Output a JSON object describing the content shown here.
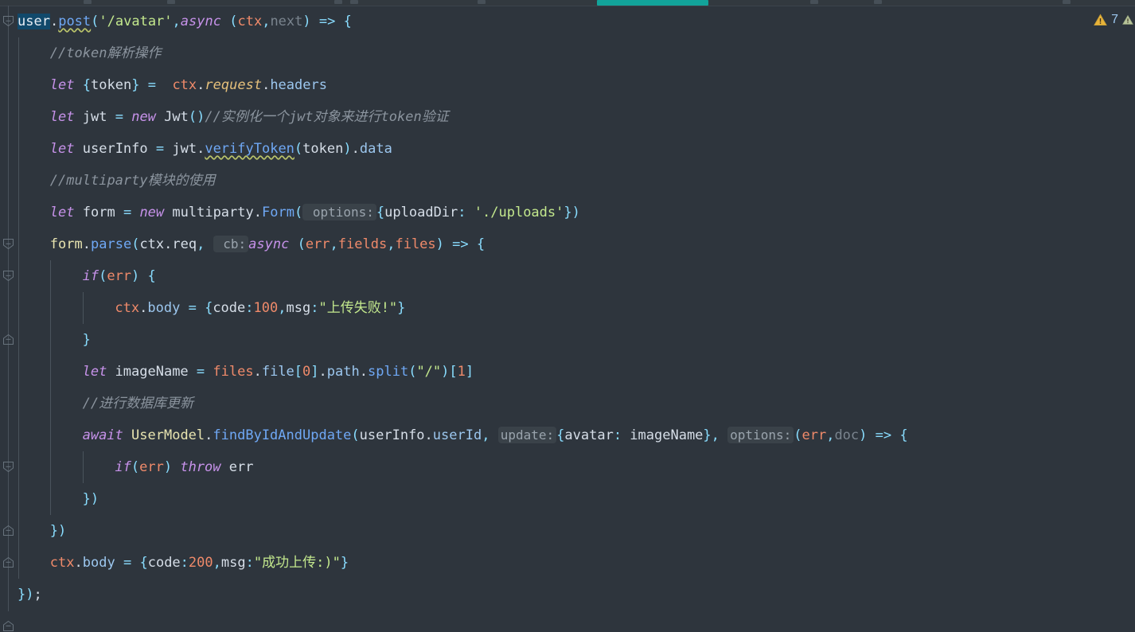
{
  "app": {
    "kind": "code-editor",
    "background": "#2e353d",
    "font_size_px": 17,
    "line_height_px": 40
  },
  "toolbar": {
    "active_tab_color": "#12a39a"
  },
  "status_bar": {
    "warning_icon": "warning-triangle-icon",
    "warning_count": "7",
    "secondary_icon": "weak-warning-triangle-icon"
  },
  "gutter": {
    "fold_markers": [
      {
        "type": "fold-start",
        "line": 1
      },
      {
        "type": "fold-start",
        "line": 8
      },
      {
        "type": "fold-start",
        "line": 9
      },
      {
        "type": "fold-end",
        "line": 11
      },
      {
        "type": "fold-start",
        "line": 15
      },
      {
        "type": "fold-end",
        "line": 17
      },
      {
        "type": "fold-end",
        "line": 18
      },
      {
        "type": "fold-end",
        "line": 20
      }
    ]
  },
  "code": {
    "language": "javascript",
    "selected_token": "user",
    "lines": [
      {
        "n": 1,
        "indent": 0,
        "tokens": [
          {
            "t": "user",
            "c": "obj sel"
          },
          {
            "t": ".",
            "c": "id"
          },
          {
            "t": "post",
            "c": "fn wavy"
          },
          {
            "t": "(",
            "c": "punc"
          },
          {
            "t": "'/avatar'",
            "c": "str"
          },
          {
            "t": ",",
            "c": "punc"
          },
          {
            "t": "async",
            "c": "kw"
          },
          {
            "t": " ",
            "c": "id"
          },
          {
            "t": "(",
            "c": "punc"
          },
          {
            "t": "ctx",
            "c": "obj"
          },
          {
            "t": ",",
            "c": "punc"
          },
          {
            "t": "next",
            "c": "dim"
          },
          {
            "t": ")",
            "c": "punc"
          },
          {
            "t": " => ",
            "c": "punc"
          },
          {
            "t": "{",
            "c": "punc"
          }
        ]
      },
      {
        "n": 2,
        "indent": 1,
        "tokens": [
          {
            "t": "//token解析操作",
            "c": "cmt"
          }
        ]
      },
      {
        "n": 3,
        "indent": 1,
        "tokens": [
          {
            "t": "let",
            "c": "kw"
          },
          {
            "t": " ",
            "c": "id"
          },
          {
            "t": "{",
            "c": "punc"
          },
          {
            "t": "token",
            "c": "id"
          },
          {
            "t": "}",
            "c": "punc"
          },
          {
            "t": " ",
            "c": "id"
          },
          {
            "t": "=",
            "c": "op"
          },
          {
            "t": "  ",
            "c": "id"
          },
          {
            "t": "ctx",
            "c": "obj"
          },
          {
            "t": ".",
            "c": "id"
          },
          {
            "t": "request",
            "c": "propy"
          },
          {
            "t": ".",
            "c": "id"
          },
          {
            "t": "headers",
            "c": "prop"
          }
        ]
      },
      {
        "n": 4,
        "indent": 1,
        "tokens": [
          {
            "t": "let",
            "c": "kw"
          },
          {
            "t": " jwt ",
            "c": "id"
          },
          {
            "t": "=",
            "c": "op"
          },
          {
            "t": " ",
            "c": "id"
          },
          {
            "t": "new",
            "c": "kw"
          },
          {
            "t": " Jwt",
            "c": "id"
          },
          {
            "t": "()",
            "c": "punc"
          },
          {
            "t": "//实例化一个jwt对象来进行token验证",
            "c": "cmt"
          }
        ]
      },
      {
        "n": 5,
        "indent": 1,
        "tokens": [
          {
            "t": "let",
            "c": "kw"
          },
          {
            "t": " userInfo ",
            "c": "id"
          },
          {
            "t": "=",
            "c": "op"
          },
          {
            "t": " jwt",
            "c": "id"
          },
          {
            "t": ".",
            "c": "id"
          },
          {
            "t": "verifyToken",
            "c": "fn wavy"
          },
          {
            "t": "(",
            "c": "punc"
          },
          {
            "t": "token",
            "c": "id"
          },
          {
            "t": ")",
            "c": "punc"
          },
          {
            "t": ".",
            "c": "id"
          },
          {
            "t": "data",
            "c": "prop"
          }
        ]
      },
      {
        "n": 6,
        "indent": 1,
        "tokens": [
          {
            "t": "//multiparty模块的使用",
            "c": "cmt"
          }
        ]
      },
      {
        "n": 7,
        "indent": 1,
        "tokens": [
          {
            "t": "let",
            "c": "kw"
          },
          {
            "t": " form ",
            "c": "id"
          },
          {
            "t": "=",
            "c": "op"
          },
          {
            "t": " ",
            "c": "id"
          },
          {
            "t": "new",
            "c": "kw"
          },
          {
            "t": " multiparty",
            "c": "id"
          },
          {
            "t": ".",
            "c": "id"
          },
          {
            "t": "Form",
            "c": "fn"
          },
          {
            "t": "(",
            "c": "punc"
          },
          {
            "t": " options:",
            "c": "hint"
          },
          {
            "t": "{",
            "c": "punc"
          },
          {
            "t": "uploadDir",
            "c": "id"
          },
          {
            "t": ":",
            "c": "punc"
          },
          {
            "t": " ",
            "c": "id"
          },
          {
            "t": "'./uploads'",
            "c": "str"
          },
          {
            "t": "}",
            "c": "punc"
          },
          {
            "t": ")",
            "c": "punc"
          }
        ]
      },
      {
        "n": 8,
        "indent": 1,
        "tokens": [
          {
            "t": "form",
            "c": "cls"
          },
          {
            "t": ".",
            "c": "id"
          },
          {
            "t": "parse",
            "c": "fn"
          },
          {
            "t": "(",
            "c": "punc"
          },
          {
            "t": "ctx",
            "c": "id"
          },
          {
            "t": ".",
            "c": "id"
          },
          {
            "t": "req",
            "c": "id"
          },
          {
            "t": ", ",
            "c": "punc"
          },
          {
            "t": " cb:",
            "c": "hint"
          },
          {
            "t": "async",
            "c": "kw"
          },
          {
            "t": " ",
            "c": "id"
          },
          {
            "t": "(",
            "c": "punc"
          },
          {
            "t": "err",
            "c": "obj"
          },
          {
            "t": ",",
            "c": "punc"
          },
          {
            "t": "fields",
            "c": "obj"
          },
          {
            "t": ",",
            "c": "punc"
          },
          {
            "t": "files",
            "c": "obj"
          },
          {
            "t": ")",
            "c": "punc"
          },
          {
            "t": " => ",
            "c": "punc"
          },
          {
            "t": "{",
            "c": "punc"
          }
        ]
      },
      {
        "n": 9,
        "indent": 2,
        "tokens": [
          {
            "t": "if",
            "c": "kw"
          },
          {
            "t": "(",
            "c": "punc"
          },
          {
            "t": "err",
            "c": "obj"
          },
          {
            "t": ")",
            "c": "punc"
          },
          {
            "t": " ",
            "c": "id"
          },
          {
            "t": "{",
            "c": "punc"
          }
        ]
      },
      {
        "n": 10,
        "indent": 3,
        "tokens": [
          {
            "t": "ctx",
            "c": "obj"
          },
          {
            "t": ".",
            "c": "id"
          },
          {
            "t": "body",
            "c": "prop"
          },
          {
            "t": " ",
            "c": "id"
          },
          {
            "t": "=",
            "c": "op"
          },
          {
            "t": " ",
            "c": "id"
          },
          {
            "t": "{",
            "c": "punc"
          },
          {
            "t": "code",
            "c": "id"
          },
          {
            "t": ":",
            "c": "punc"
          },
          {
            "t": "100",
            "c": "num"
          },
          {
            "t": ",",
            "c": "punc"
          },
          {
            "t": "msg",
            "c": "id"
          },
          {
            "t": ":",
            "c": "punc"
          },
          {
            "t": "\"上传失败!\"",
            "c": "str"
          },
          {
            "t": "}",
            "c": "punc"
          }
        ]
      },
      {
        "n": 11,
        "indent": 2,
        "tokens": [
          {
            "t": "}",
            "c": "punc"
          }
        ]
      },
      {
        "n": 12,
        "indent": 2,
        "tokens": [
          {
            "t": "let",
            "c": "kw"
          },
          {
            "t": " imageName ",
            "c": "id"
          },
          {
            "t": "=",
            "c": "op"
          },
          {
            "t": " ",
            "c": "id"
          },
          {
            "t": "files",
            "c": "obj"
          },
          {
            "t": ".",
            "c": "id"
          },
          {
            "t": "file",
            "c": "prop"
          },
          {
            "t": "[",
            "c": "punc"
          },
          {
            "t": "0",
            "c": "num"
          },
          {
            "t": "]",
            "c": "punc"
          },
          {
            "t": ".",
            "c": "id"
          },
          {
            "t": "path",
            "c": "prop"
          },
          {
            "t": ".",
            "c": "id"
          },
          {
            "t": "split",
            "c": "fn"
          },
          {
            "t": "(",
            "c": "punc"
          },
          {
            "t": "\"/\"",
            "c": "str"
          },
          {
            "t": ")",
            "c": "punc"
          },
          {
            "t": "[",
            "c": "punc"
          },
          {
            "t": "1",
            "c": "num"
          },
          {
            "t": "]",
            "c": "punc"
          }
        ]
      },
      {
        "n": 13,
        "indent": 2,
        "tokens": [
          {
            "t": "//进行数据库更新",
            "c": "cmt"
          }
        ]
      },
      {
        "n": 14,
        "indent": 2,
        "tokens": [
          {
            "t": "await",
            "c": "kw"
          },
          {
            "t": " ",
            "c": "id"
          },
          {
            "t": "UserModel",
            "c": "cls"
          },
          {
            "t": ".",
            "c": "id"
          },
          {
            "t": "findByIdAndUpdate",
            "c": "fn"
          },
          {
            "t": "(",
            "c": "punc"
          },
          {
            "t": "userInfo",
            "c": "id"
          },
          {
            "t": ".",
            "c": "id"
          },
          {
            "t": "userId",
            "c": "prop"
          },
          {
            "t": ", ",
            "c": "punc"
          },
          {
            "t": "update:",
            "c": "hint"
          },
          {
            "t": "{",
            "c": "punc"
          },
          {
            "t": "avatar",
            "c": "id"
          },
          {
            "t": ":",
            "c": "punc"
          },
          {
            "t": " imageName",
            "c": "id"
          },
          {
            "t": "}",
            "c": "punc"
          },
          {
            "t": ", ",
            "c": "punc"
          },
          {
            "t": "options:",
            "c": "hint"
          },
          {
            "t": "(",
            "c": "punc"
          },
          {
            "t": "err",
            "c": "obj"
          },
          {
            "t": ",",
            "c": "punc"
          },
          {
            "t": "doc",
            "c": "dim"
          },
          {
            "t": ")",
            "c": "punc"
          },
          {
            "t": " => ",
            "c": "punc"
          },
          {
            "t": "{",
            "c": "punc"
          }
        ]
      },
      {
        "n": 15,
        "indent": 3,
        "tokens": [
          {
            "t": "if",
            "c": "kw"
          },
          {
            "t": "(",
            "c": "punc"
          },
          {
            "t": "err",
            "c": "obj"
          },
          {
            "t": ")",
            "c": "punc"
          },
          {
            "t": " ",
            "c": "id"
          },
          {
            "t": "throw",
            "c": "kw"
          },
          {
            "t": " err",
            "c": "id"
          }
        ]
      },
      {
        "n": 16,
        "indent": 2,
        "tokens": [
          {
            "t": "})",
            "c": "punc"
          }
        ]
      },
      {
        "n": 17,
        "indent": 1,
        "tokens": [
          {
            "t": "})",
            "c": "punc"
          }
        ]
      },
      {
        "n": 18,
        "indent": 1,
        "tokens": [
          {
            "t": "ctx",
            "c": "obj"
          },
          {
            "t": ".",
            "c": "id"
          },
          {
            "t": "body",
            "c": "prop"
          },
          {
            "t": " ",
            "c": "id"
          },
          {
            "t": "=",
            "c": "op"
          },
          {
            "t": " ",
            "c": "id"
          },
          {
            "t": "{",
            "c": "punc"
          },
          {
            "t": "code",
            "c": "id"
          },
          {
            "t": ":",
            "c": "punc"
          },
          {
            "t": "200",
            "c": "num"
          },
          {
            "t": ",",
            "c": "punc"
          },
          {
            "t": "msg",
            "c": "id"
          },
          {
            "t": ":",
            "c": "punc"
          },
          {
            "t": "\"成功上传:)\"",
            "c": "str"
          },
          {
            "t": "}",
            "c": "punc"
          }
        ]
      },
      {
        "n": 19,
        "indent": 0,
        "tokens": [
          {
            "t": "}",
            "c": "punc"
          },
          {
            "t": ")",
            "c": "punc"
          },
          {
            "t": ";",
            "c": "id"
          }
        ]
      }
    ]
  }
}
